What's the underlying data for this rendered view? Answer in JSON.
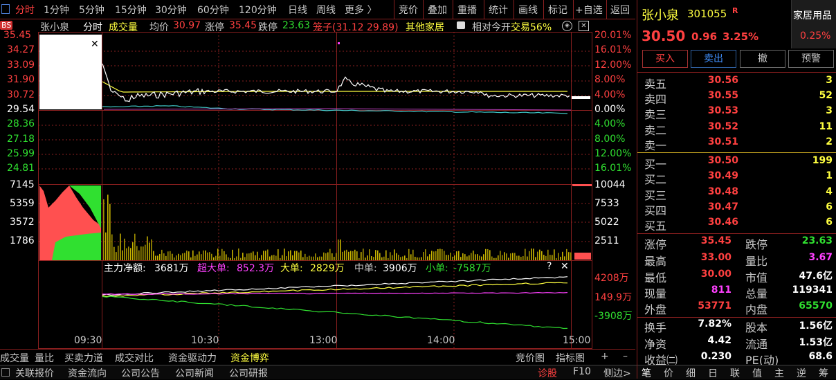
{
  "toolbar": {
    "periods": [
      "分时",
      "1分钟",
      "5分钟",
      "15分钟",
      "30分钟",
      "60分钟",
      "120分钟",
      "日线",
      "周线",
      "更多 〉"
    ],
    "tools": [
      "竞价",
      "叠加",
      "重播",
      "统计",
      "画线",
      "标记",
      "+自选",
      "返回"
    ]
  },
  "info": {
    "name": "张小泉",
    "mode": "分时",
    "vol_label": "成交量",
    "avg_label": "均价",
    "avg_value": "30.97",
    "up_label": "涨停",
    "up_value": "35.45",
    "down_label": "跌停",
    "down_value": "23.63",
    "cage": "笼子(31.12 29.89)",
    "other": "其他家居",
    "relative": "相对今开",
    "overlay": "交易56%"
  },
  "badge": "BS",
  "price_axis_left": [
    "35.45",
    "34.27",
    "33.09",
    "31.90",
    "30.72",
    "29.54",
    "28.36",
    "27.18",
    "25.99",
    "24.81"
  ],
  "pct_axis_right": [
    "20.01%",
    "16.01%",
    "12.00%",
    "8.00%",
    "4.00%",
    "0.00%",
    "4.00%",
    "8.00%",
    "12.00%",
    "16.01%"
  ],
  "vol_axis_left": [
    "7145",
    "5359",
    "3572",
    "1786"
  ],
  "vol_axis_right": [
    "10044",
    "7533",
    "5022",
    "2511"
  ],
  "fund": {
    "net_label": "主力净额:",
    "net_value": "3681万",
    "super_label": "超大单:",
    "super_value": "852.3万",
    "big_label": "大单:",
    "big_value": "2829万",
    "mid_label": "中单:",
    "mid_value": "3906万",
    "small_label": "小单:",
    "small_value": "-7587万",
    "axis": [
      "4208万",
      "149.9万",
      "-3908万"
    ]
  },
  "time_axis": [
    "09:30",
    "10:30",
    "13:00",
    "14:00",
    "15:00"
  ],
  "bottom_tabs": [
    "成交量",
    "量比",
    "买卖力道",
    "成交对比",
    "资金驱动力",
    "资金博弈"
  ],
  "bottom_right": [
    "竞价图",
    "指标图",
    "+",
    "–"
  ],
  "status": [
    "关联报价",
    "资金流向",
    "公司公告",
    "公司新闻",
    "公司研报"
  ],
  "status_right": [
    "诊股",
    "F10",
    "侧边>"
  ],
  "stock": {
    "name": "张小泉",
    "code": "301055",
    "tag": "R",
    "sector": "家居用品",
    "sector_pct": "0.25%",
    "price": "30.50",
    "change": "0.96",
    "change_pct": "3.25%"
  },
  "trade_buttons": [
    "买入",
    "卖出",
    "撤",
    "预警"
  ],
  "asks": [
    {
      "label": "卖五",
      "price": "30.56",
      "vol": "3"
    },
    {
      "label": "卖四",
      "price": "30.55",
      "vol": "52"
    },
    {
      "label": "卖三",
      "price": "30.53",
      "vol": "3"
    },
    {
      "label": "卖二",
      "price": "30.52",
      "vol": "11"
    },
    {
      "label": "卖一",
      "price": "30.51",
      "vol": "2"
    }
  ],
  "bids": [
    {
      "label": "买一",
      "price": "30.50",
      "vol": "199"
    },
    {
      "label": "买二",
      "price": "30.49",
      "vol": "1"
    },
    {
      "label": "买三",
      "price": "30.48",
      "vol": "4"
    },
    {
      "label": "买四",
      "price": "30.47",
      "vol": "6"
    },
    {
      "label": "买五",
      "price": "30.46",
      "vol": "6"
    }
  ],
  "stats": [
    {
      "l": "涨停",
      "lv": "35.45",
      "r": "跌停",
      "rv": "23.63"
    },
    {
      "l": "最高",
      "lv": "33.00",
      "r": "量比",
      "rv": "3.67"
    },
    {
      "l": "最低",
      "lv": "30.00",
      "r": "市值",
      "rv": "47.6亿"
    },
    {
      "l": "现量",
      "lv": "811",
      "r": "总量",
      "rv": "119341"
    },
    {
      "l": "外盘",
      "lv": "53771",
      "r": "内盘",
      "rv": "65570"
    }
  ],
  "stats2": [
    {
      "l": "换手",
      "lv": "7.82%",
      "r": "股本",
      "rv": "1.56亿"
    },
    {
      "l": "净资",
      "lv": "4.42",
      "r": "流通",
      "rv": "1.53亿"
    },
    {
      "l": "收益㈡",
      "lv": "0.230",
      "r": "PE(动)",
      "rv": "68.6"
    }
  ],
  "right_tabs": [
    "笔",
    "价",
    "细",
    "日",
    "联",
    "值",
    "主",
    "逆",
    "筹"
  ],
  "colors": {
    "up": "#ff4040",
    "down": "#30e030",
    "grid": "#8a1f1f",
    "price_line": "#ffffff",
    "avg_line": "#ffff40"
  }
}
